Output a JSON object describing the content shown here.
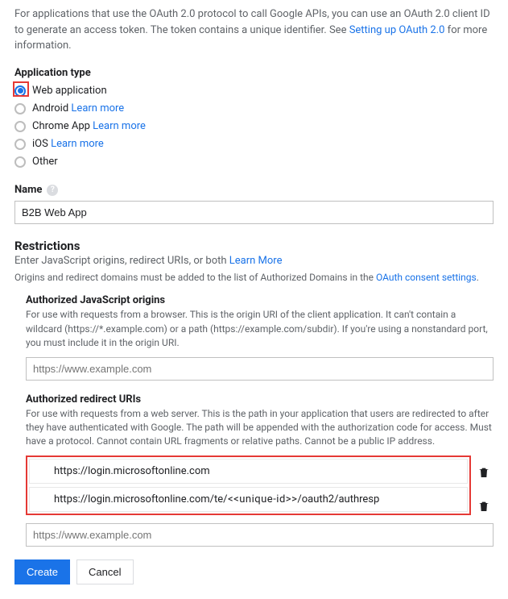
{
  "intro_pre": "For applications that use the OAuth 2.0 protocol to call Google APIs, you can use an OAuth 2.0 client ID to generate an access token. The token contains a unique identifier. See ",
  "intro_link": "Setting up OAuth 2.0",
  "intro_post": " for more information.",
  "app_type_label": "Application type",
  "radios": [
    {
      "label": "Web application",
      "link": ""
    },
    {
      "label": "Android",
      "link": "Learn more"
    },
    {
      "label": "Chrome App",
      "link": "Learn more"
    },
    {
      "label": "iOS",
      "link": "Learn more"
    },
    {
      "label": "Other",
      "link": ""
    }
  ],
  "name_label": "Name",
  "help_glyph": "?",
  "name_value": "B2B Web App",
  "restrictions": {
    "title": "Restrictions",
    "sub_pre": "Enter JavaScript origins, redirect URIs, or both ",
    "sub_link": "Learn More",
    "note_pre": "Origins and redirect domains must be added to the list of Authorized Domains in the ",
    "note_link": "OAuth consent settings",
    "note_post": "."
  },
  "js_origins": {
    "label": "Authorized JavaScript origins",
    "desc": "For use with requests from a browser. This is the origin URI of the client application. It can't contain a wildcard (https://*.example.com) or a path (https://example.com/subdir). If you're using a nonstandard port, you must include it in the origin URI.",
    "placeholder": "https://www.example.com"
  },
  "redirect": {
    "label": "Authorized redirect URIs",
    "desc": "For use with requests from a web server. This is the path in your application that users are redirected to after they have authenticated with Google. The path will be appended with the authorization code for access. Must have a protocol. Cannot contain URL fragments or relative paths. Cannot be a public IP address.",
    "rows": [
      "https://login.microsoftonline.com",
      "https://login.microsoftonline.com/te/<<unique-id>>/oauth2/authresp"
    ],
    "row2_pre": "https://login.microsoftonline.com/te",
    "row2_mid": "/<<unique-id>>",
    "row2_post": "/oauth2/authresp",
    "placeholder": "https://www.example.com"
  },
  "buttons": {
    "create": "Create",
    "cancel": "Cancel"
  }
}
